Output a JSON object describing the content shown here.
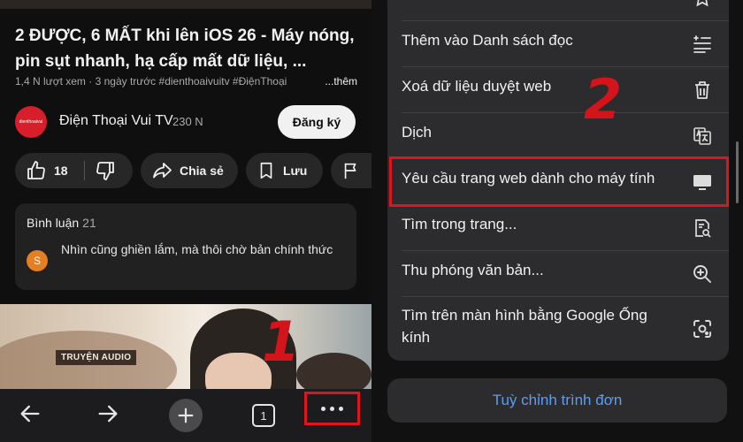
{
  "video": {
    "title": "2 ĐƯỢC, 6 MẤT khi lên iOS 26 - Máy nóng, pin sụt nhanh, hạ cấp mất dữ liệu, ...",
    "meta": "1,4 N lượt xem · 3 ngày trước  #dienthoaivuitv #ĐiệnThoại",
    "meta_more": "...thêm"
  },
  "channel": {
    "avatar_text": "dienthoaivui",
    "name": "Điện Thoại Vui TV",
    "subs": "230 N",
    "subscribe_label": "Đăng ký"
  },
  "actions": {
    "like_count": "18",
    "share_label": "Chia sẻ",
    "save_label": "Lưu"
  },
  "comments": {
    "header": "Bình luận",
    "count": "21",
    "avatar_letter": "S",
    "text": "Nhìn cũng ghiền lắm, mà thôi chờ bản chính thức"
  },
  "next_video": {
    "badge": "TRUYỆN AUDIO"
  },
  "annotations": {
    "step1": "1",
    "step2": "2",
    "color": "#d3141b"
  },
  "toolbar": {
    "tab_count": "1",
    "icons": [
      "back-arrow-icon",
      "forward-arrow-icon",
      "plus-icon",
      "tab-switcher-icon",
      "more-dots-icon"
    ]
  },
  "menu": {
    "items": [
      {
        "label": "Thêm vào Danh sách đọc",
        "icon": "reading-list-icon"
      },
      {
        "label": "Xoá dữ liệu duyệt web",
        "icon": "trash-icon"
      },
      {
        "label": "Dịch",
        "icon": "translate-icon"
      },
      {
        "label": "Yêu cầu trang web dành cho máy tính",
        "icon": "desktop-icon"
      },
      {
        "label": "Tìm trong trang...",
        "icon": "find-in-page-icon"
      },
      {
        "label": "Thu phóng văn bản...",
        "icon": "zoom-icon"
      },
      {
        "label": "Tìm trên màn hình bằng Google Ống kính",
        "icon": "google-lens-icon"
      }
    ],
    "customize_label": "Tuỳ chỉnh trình đơn"
  }
}
